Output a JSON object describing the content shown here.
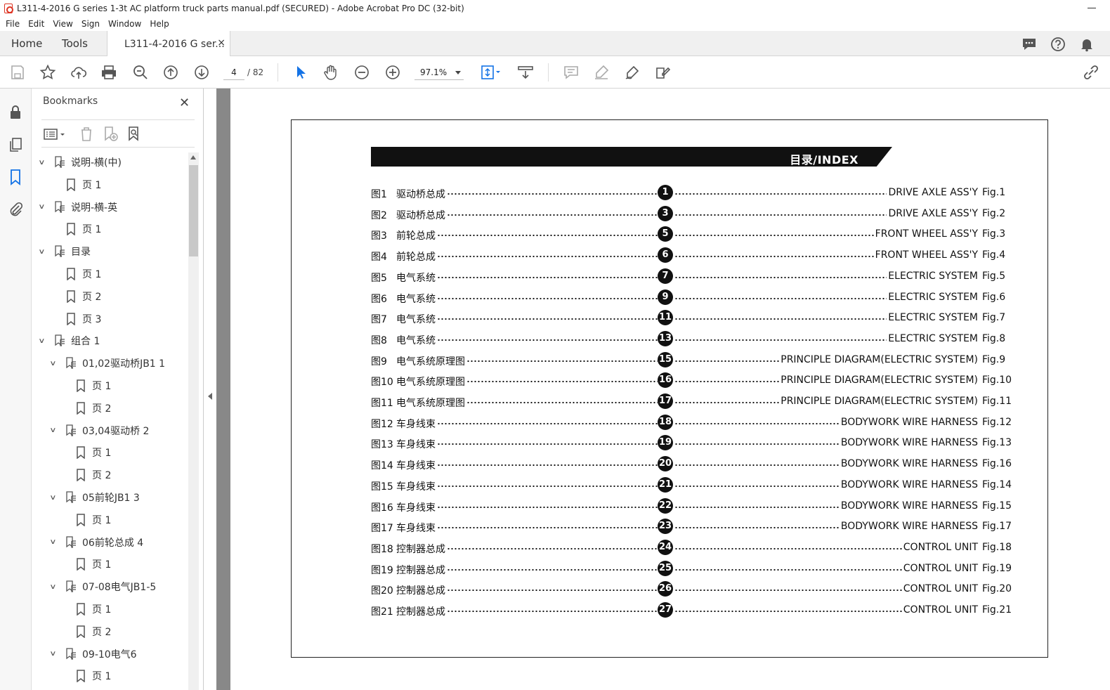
{
  "window": {
    "title": "L311-4-2016 G series 1-3t AC platform truck parts manual.pdf (SECURED) - Adobe Acrobat Pro DC (32-bit)"
  },
  "menu": [
    "File",
    "Edit",
    "View",
    "Sign",
    "Window",
    "Help"
  ],
  "tabs": {
    "home": "Home",
    "tools": "Tools",
    "doc": "L311-4-2016 G ser...",
    "close": "×"
  },
  "toolbar": {
    "page_current": "4",
    "page_total": "/ 82",
    "zoom": "97.1%"
  },
  "bookmarks": {
    "title": "Bookmarks",
    "close": "✕",
    "items": [
      {
        "label": "说明-横(中)",
        "type": "group",
        "level": 0
      },
      {
        "label": "页 1",
        "type": "page",
        "level": 1
      },
      {
        "label": "说明-横-英",
        "type": "group",
        "level": 0
      },
      {
        "label": "页 1",
        "type": "page",
        "level": 1
      },
      {
        "label": "目录",
        "type": "group",
        "level": 0
      },
      {
        "label": "页 1",
        "type": "page",
        "level": 1
      },
      {
        "label": "页 2",
        "type": "page",
        "level": 1
      },
      {
        "label": "页 3",
        "type": "page",
        "level": 1
      },
      {
        "label": "组合 1",
        "type": "group",
        "level": 0
      },
      {
        "label": "01,02驱动桥JB1  1",
        "type": "group",
        "level": 1
      },
      {
        "label": "页 1",
        "type": "page",
        "level": 2
      },
      {
        "label": "页 2",
        "type": "page",
        "level": 2
      },
      {
        "label": "03,04驱动桥 2",
        "type": "group",
        "level": 1
      },
      {
        "label": "页 1",
        "type": "page",
        "level": 2
      },
      {
        "label": "页 2",
        "type": "page",
        "level": 2
      },
      {
        "label": "05前轮JB1  3",
        "type": "group",
        "level": 1
      },
      {
        "label": "页 1",
        "type": "page",
        "level": 2
      },
      {
        "label": "06前轮总成 4",
        "type": "group",
        "level": 1
      },
      {
        "label": "页 1",
        "type": "page",
        "level": 2
      },
      {
        "label": "07-08电气JB1-5",
        "type": "group",
        "level": 1
      },
      {
        "label": "页 1",
        "type": "page",
        "level": 2
      },
      {
        "label": "页 2",
        "type": "page",
        "level": 2
      },
      {
        "label": "09-10电气6",
        "type": "group",
        "level": 1
      },
      {
        "label": "页 1",
        "type": "page",
        "level": 2
      }
    ]
  },
  "document": {
    "heading": "目录/INDEX",
    "rows": [
      {
        "fig": "图1",
        "cn": "驱动桥总成",
        "num": "1",
        "en": "DRIVE AXLE ASS'Y",
        "fg": "Fig.1"
      },
      {
        "fig": "图2",
        "cn": "驱动桥总成",
        "num": "3",
        "en": "DRIVE AXLE ASS'Y",
        "fg": "Fig.2"
      },
      {
        "fig": "图3",
        "cn": "前轮总成",
        "num": "5",
        "en": "FRONT WHEEL ASS'Y",
        "fg": "Fig.3"
      },
      {
        "fig": "图4",
        "cn": "前轮总成",
        "num": "6",
        "en": "FRONT WHEEL ASS'Y",
        "fg": "Fig.4"
      },
      {
        "fig": "图5",
        "cn": "电气系统",
        "num": "7",
        "en": "ELECTRIC SYSTEM",
        "fg": "Fig.5"
      },
      {
        "fig": "图6",
        "cn": "电气系统",
        "num": "9",
        "en": "ELECTRIC SYSTEM",
        "fg": "Fig.6"
      },
      {
        "fig": "图7",
        "cn": "电气系统",
        "num": "11",
        "en": "ELECTRIC SYSTEM",
        "fg": "Fig.7"
      },
      {
        "fig": "图8",
        "cn": "电气系统",
        "num": "13",
        "en": "ELECTRIC SYSTEM",
        "fg": "Fig.8"
      },
      {
        "fig": "图9",
        "cn": "电气系统原理图",
        "num": "15",
        "en": "PRINCIPLE DIAGRAM(ELECTRIC SYSTEM)",
        "fg": "Fig.9"
      },
      {
        "fig": "图10",
        "cn": "电气系统原理图",
        "num": "16",
        "en": "PRINCIPLE DIAGRAM(ELECTRIC SYSTEM)",
        "fg": "Fig.10"
      },
      {
        "fig": "图11",
        "cn": "电气系统原理图",
        "num": "17",
        "en": "PRINCIPLE DIAGRAM(ELECTRIC SYSTEM)",
        "fg": "Fig.11"
      },
      {
        "fig": "图12",
        "cn": "车身线束",
        "num": "18",
        "en": "BODYWORK WIRE HARNESS",
        "fg": "Fig.12"
      },
      {
        "fig": "图13",
        "cn": "车身线束",
        "num": "19",
        "en": "BODYWORK WIRE HARNESS",
        "fg": "Fig.13"
      },
      {
        "fig": "图14",
        "cn": "车身线束",
        "num": "20",
        "en": "BODYWORK WIRE HARNESS",
        "fg": "Fig.16"
      },
      {
        "fig": "图15",
        "cn": "车身线束",
        "num": "21",
        "en": "BODYWORK WIRE HARNESS",
        "fg": "Fig.14"
      },
      {
        "fig": "图16",
        "cn": "车身线束",
        "num": "22",
        "en": "BODYWORK WIRE HARNESS",
        "fg": "Fig.15"
      },
      {
        "fig": "图17",
        "cn": "车身线束",
        "num": "23",
        "en": "BODYWORK WIRE HARNESS",
        "fg": "Fig.17"
      },
      {
        "fig": "图18",
        "cn": "控制器总成",
        "num": "24",
        "en": "CONTROL UNIT",
        "fg": "Fig.18"
      },
      {
        "fig": "图19",
        "cn": "控制器总成",
        "num": "25",
        "en": "CONTROL UNIT",
        "fg": "Fig.19"
      },
      {
        "fig": "图20",
        "cn": "控制器总成",
        "num": "26",
        "en": "CONTROL UNIT",
        "fg": "Fig.20"
      },
      {
        "fig": "图21",
        "cn": "控制器总成",
        "num": "27",
        "en": "CONTROL UNIT",
        "fg": "Fig.21"
      }
    ]
  },
  "colors": {
    "accent": "#1473e6",
    "ink": "#111111",
    "viewer_bg": "#888888"
  }
}
